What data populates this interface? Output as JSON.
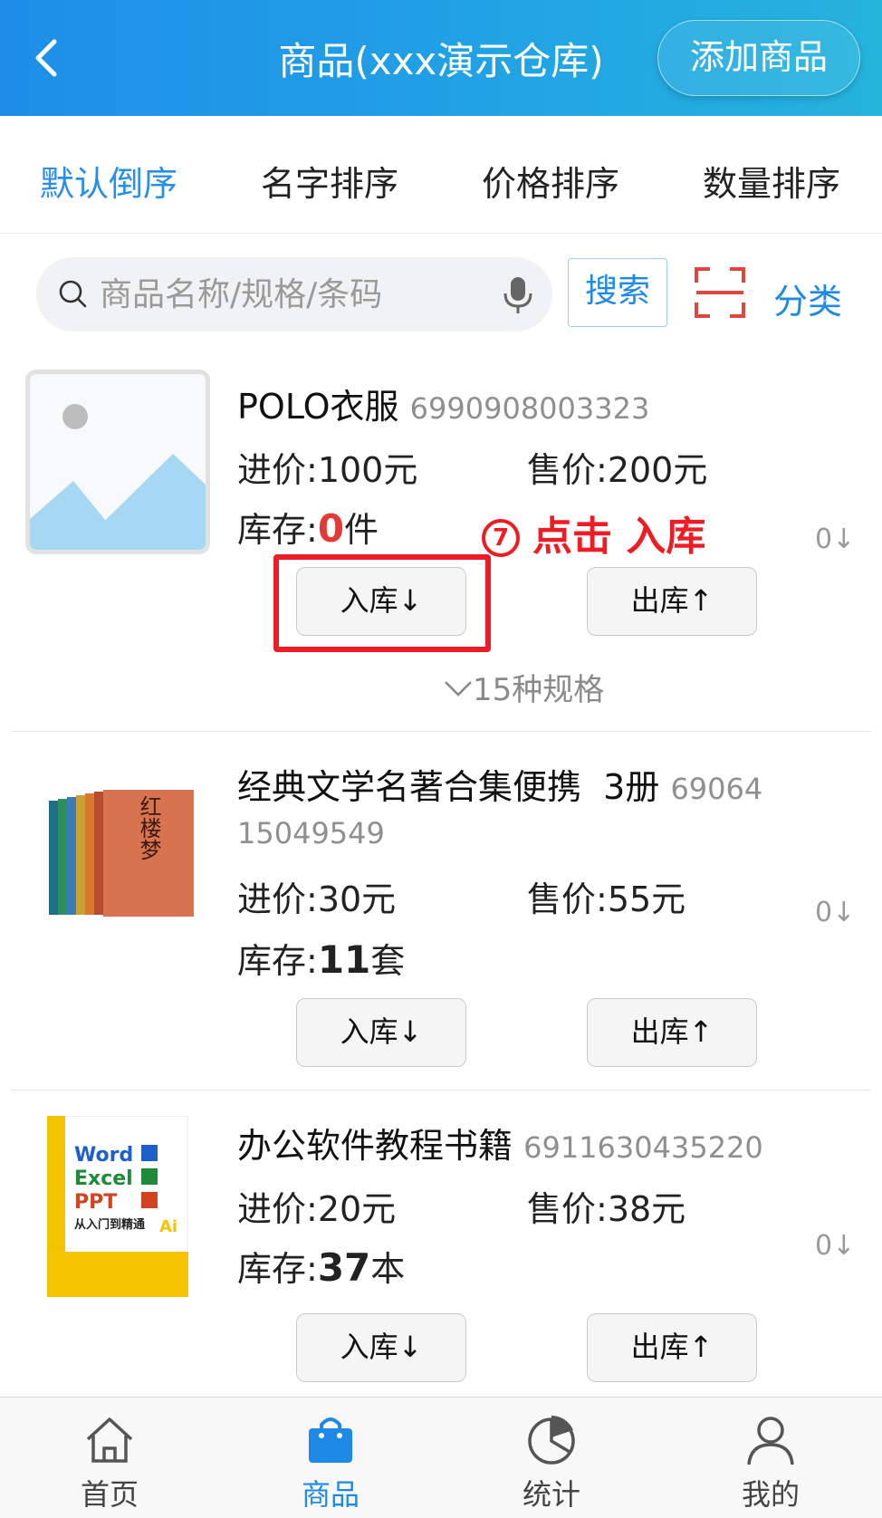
{
  "header": {
    "title": "商品(xxx演示仓库)",
    "add_button": "添加商品"
  },
  "sort_tabs": [
    {
      "label": "默认倒序",
      "active": true
    },
    {
      "label": "名字排序",
      "active": false
    },
    {
      "label": "价格排序",
      "active": false
    },
    {
      "label": "数量排序",
      "active": false
    }
  ],
  "search": {
    "placeholder": "商品名称/规格/条码",
    "button": "搜索",
    "category": "分类"
  },
  "labels": {
    "purchase": "进价:",
    "sale": "售价:",
    "stock": "库存:",
    "in_button": "入库↓",
    "out_button": "出库↑"
  },
  "products": [
    {
      "name": "POLO衣服",
      "code": "6990908003323",
      "purchase_price": "100元",
      "sale_price": "200元",
      "stock_value": "0",
      "stock_unit": "件",
      "pending": "0↓",
      "specs": "15种规格"
    },
    {
      "name": "经典文学名著合集便携  3册",
      "code_line1": "69064",
      "code_line2": "15049549",
      "purchase_price": "30元",
      "sale_price": "55元",
      "stock_value": "11",
      "stock_unit": "套",
      "pending": "0↓",
      "cover_text": "红楼梦"
    },
    {
      "name": "办公软件教程书籍",
      "code": "6911630435220",
      "purchase_price": "20元",
      "sale_price": "38元",
      "stock_value": "37",
      "stock_unit": "本",
      "pending": "0↓",
      "cover_text": {
        "word": "Word",
        "excel": "Excel",
        "ppt": "PPT",
        "subtitle": "从入门到精通",
        "ai": "Ai"
      }
    }
  ],
  "annotation": {
    "step": "7",
    "text": "点击 入库"
  },
  "bottom_nav": [
    {
      "label": "首页",
      "icon": "home-icon",
      "active": false
    },
    {
      "label": "商品",
      "icon": "shopping-bag-icon",
      "active": true
    },
    {
      "label": "统计",
      "icon": "pie-chart-icon",
      "active": false
    },
    {
      "label": "我的",
      "icon": "user-icon",
      "active": false
    }
  ],
  "colors": {
    "brand_blue": "#1f8ae6",
    "highlight_red": "#ee1c24",
    "stock_zero_red": "#e53935"
  }
}
